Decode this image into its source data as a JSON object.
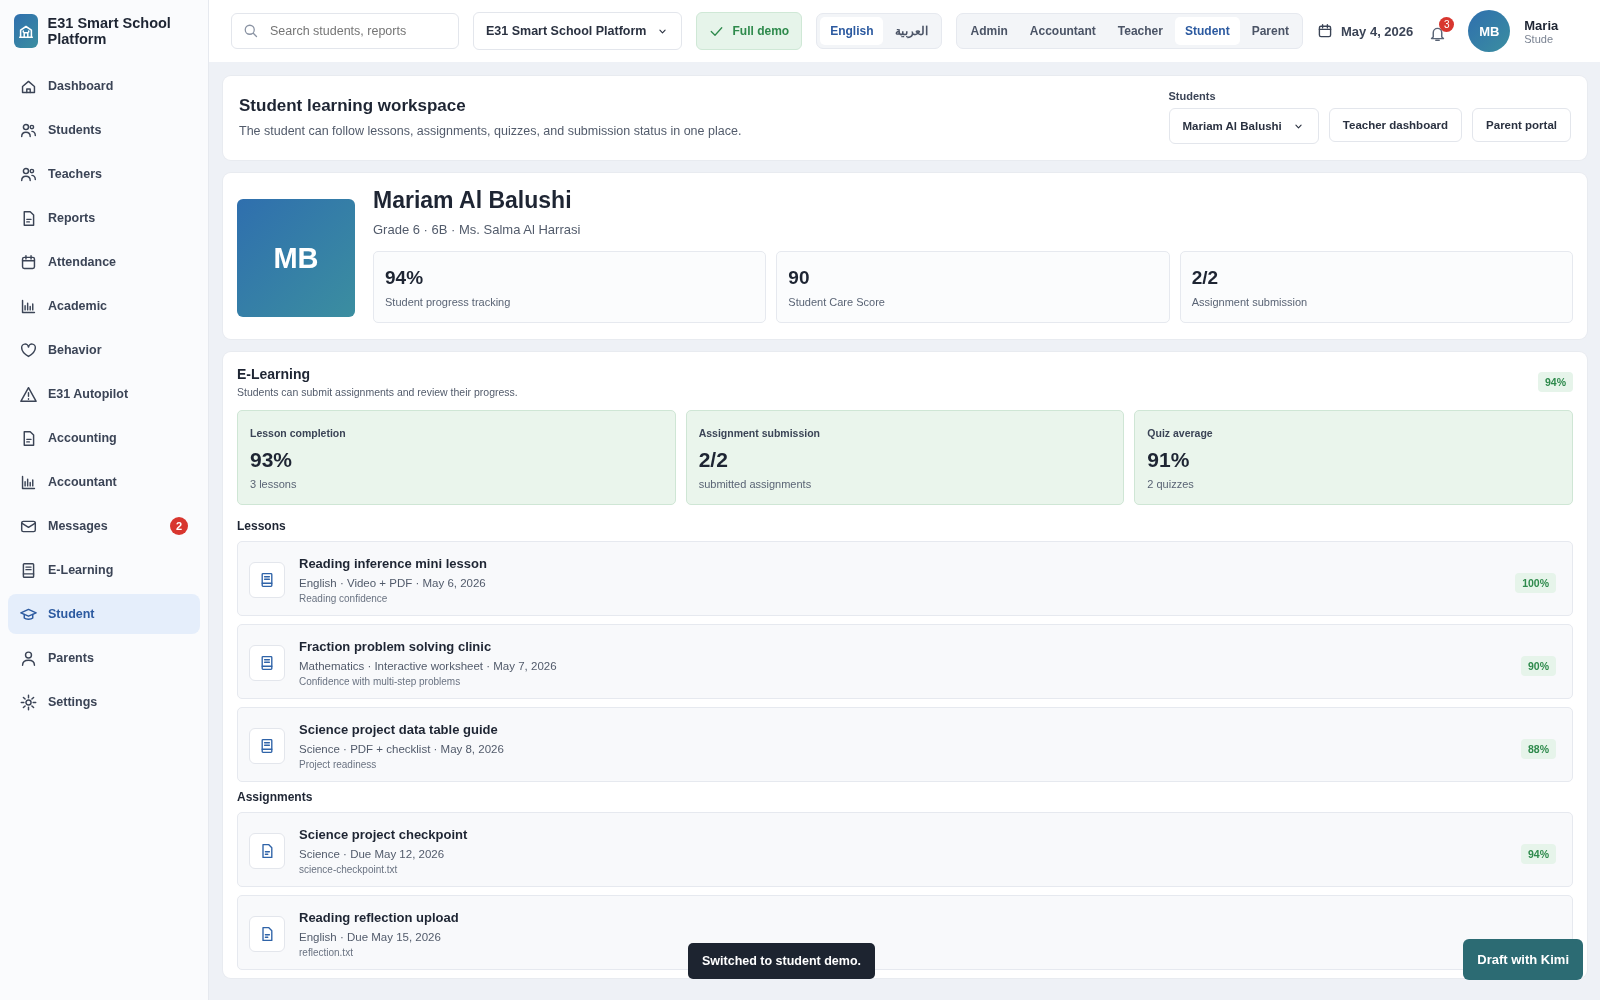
{
  "brand": {
    "name": "E31 Smart School Platform"
  },
  "sidebar": {
    "items": [
      {
        "label": "Dashboard",
        "selected": false
      },
      {
        "label": "Students",
        "selected": false
      },
      {
        "label": "Teachers",
        "selected": false
      },
      {
        "label": "Reports",
        "selected": false
      },
      {
        "label": "Attendance",
        "selected": false
      },
      {
        "label": "Academic",
        "selected": false
      },
      {
        "label": "Behavior",
        "selected": false
      },
      {
        "label": "E31 Autopilot",
        "selected": false
      },
      {
        "label": "Accounting",
        "selected": false
      },
      {
        "label": "Accountant",
        "selected": false
      },
      {
        "label": "Messages",
        "selected": false,
        "badge": "2"
      },
      {
        "label": "E-Learning",
        "selected": false
      },
      {
        "label": "Student",
        "selected": true
      },
      {
        "label": "Parents",
        "selected": false
      },
      {
        "label": "Settings",
        "selected": false
      }
    ]
  },
  "topbar": {
    "search": {
      "placeholder": "Search students, reports"
    },
    "platform_select": "E31 Smart School Platform",
    "demo_badge": "Full demo",
    "languages": [
      {
        "label": "English",
        "selected": true
      },
      {
        "label": "العربية",
        "selected": false
      }
    ],
    "roles": [
      {
        "label": "Admin",
        "selected": false
      },
      {
        "label": "Accountant",
        "selected": false
      },
      {
        "label": "Teacher",
        "selected": false
      },
      {
        "label": "Student",
        "selected": true
      },
      {
        "label": "Parent",
        "selected": false
      }
    ],
    "date": "May 4, 2026",
    "notifications": "3",
    "user": {
      "initials": "MB",
      "name": "Maria",
      "role": "Stude"
    }
  },
  "workspace": {
    "title": "Student learning workspace",
    "subtitle": "The student can follow lessons, assignments, quizzes, and submission status in one place.",
    "student_label": "Students",
    "student_select": "Mariam Al Balushi",
    "buttons": [
      "Teacher dashboard",
      "Parent portal"
    ]
  },
  "profile": {
    "initials": "MB",
    "name": "Mariam Al Balushi",
    "details": "Grade 6 · 6B · Ms. Salma Al Harrasi",
    "stats": [
      {
        "value": "94%",
        "label": "Student progress tracking"
      },
      {
        "value": "90",
        "label": "Student Care Score"
      },
      {
        "value": "2/2",
        "label": "Assignment submission"
      }
    ]
  },
  "elearning": {
    "title": "E-Learning",
    "subtitle": "Students can submit assignments and review their progress.",
    "percent": "94%",
    "stats": [
      {
        "label": "Lesson completion",
        "value": "93%",
        "note": "3 lessons"
      },
      {
        "label": "Assignment submission",
        "value": "2/2",
        "note": "submitted assignments"
      },
      {
        "label": "Quiz average",
        "value": "91%",
        "note": "2 quizzes"
      }
    ],
    "lessons_title": "Lessons",
    "lessons": [
      {
        "title": "Reading inference mini lesson",
        "meta": "English · Video + PDF · May 6, 2026",
        "note": "Reading confidence",
        "percent": "100%"
      },
      {
        "title": "Fraction problem solving clinic",
        "meta": "Mathematics · Interactive worksheet · May 7, 2026",
        "note": "Confidence with multi-step problems",
        "percent": "90%"
      },
      {
        "title": "Science project data table guide",
        "meta": "Science · PDF + checklist · May 8, 2026",
        "note": "Project readiness",
        "percent": "88%"
      }
    ],
    "assignments_title": "Assignments",
    "assignments": [
      {
        "title": "Science project checkpoint",
        "meta": "Science · Due May 12, 2026",
        "note": "science-checkpoint.txt",
        "percent": "94%"
      },
      {
        "title": "Reading reflection upload",
        "meta": "English · Due May 15, 2026",
        "note": "reflection.txt"
      }
    ]
  },
  "toast": "Switched to student demo.",
  "draft_button": "Draft with Kimi"
}
